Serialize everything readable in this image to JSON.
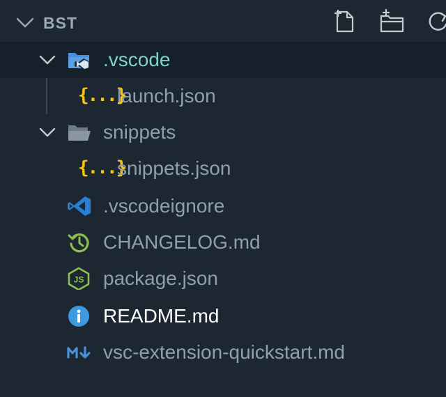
{
  "header": {
    "title": "BST"
  },
  "tree": {
    "vscode_folder": {
      "label": ".vscode"
    },
    "launch_json": {
      "label": "launch.json",
      "glyph": "{...}"
    },
    "snippets_folder": {
      "label": "snippets"
    },
    "snippets_json": {
      "label": "snippets.json",
      "glyph": "{...}"
    },
    "vscodeignore": {
      "label": ".vscodeignore"
    },
    "changelog": {
      "label": "CHANGELOG.md"
    },
    "package_json": {
      "label": "package.json"
    },
    "readme": {
      "label": "README.md"
    },
    "quickstart": {
      "label": "vsc-extension-quickstart.md"
    }
  },
  "colors": {
    "background": "#1c2731",
    "selected_row": "#16202a",
    "label_default": "#8da0ac",
    "label_vscode": "#7fd3cc",
    "label_readme": "#ffffff",
    "json_icon": "#f5c518",
    "folder_vscode": "#4a90d9",
    "folder_plain": "#8a97a2",
    "vscode_icon": "#2a7fd4",
    "changelog_icon": "#8cc152",
    "node_icon": "#8cc152",
    "info_icon": "#3b9ae1",
    "markdown_icon": "#4a90d9"
  },
  "icons": [
    "chevron-down-icon",
    "new-file-icon",
    "new-folder-icon",
    "refresh-icon",
    "folder-vscode-icon",
    "json-icon",
    "folder-open-icon",
    "vscode-logo-icon",
    "history-icon",
    "nodejs-icon",
    "info-icon",
    "markdown-icon"
  ]
}
